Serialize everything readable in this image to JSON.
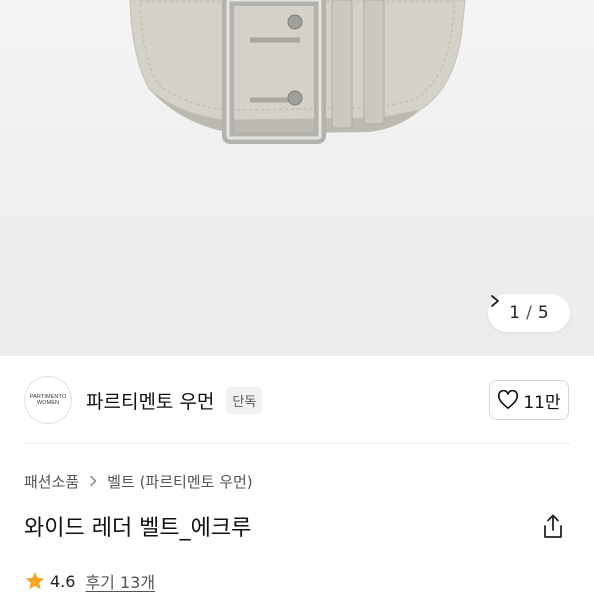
{
  "gallery": {
    "current_index": "1",
    "separator": "/",
    "total": "5",
    "image_alt": "wide leather belt ecru product photo"
  },
  "brand": {
    "logo_line1": "PARTIMENTO",
    "logo_line2": "WOMEN",
    "name": "파르티멘토 우먼",
    "badge": "단독"
  },
  "like": {
    "count": "11만",
    "icon": "heart-outline-icon"
  },
  "breadcrumb": [
    {
      "label": "패션소품"
    },
    {
      "label": "벨트 (파르티멘토 우먼)"
    }
  ],
  "product": {
    "title": "와이드 레더 벨트_에크루",
    "rating": "4.6",
    "review_label": "후기 13개"
  },
  "colors": {
    "star": "#f5a623",
    "belt": "#d3d1c7",
    "buckle": "#b9b8b3"
  }
}
